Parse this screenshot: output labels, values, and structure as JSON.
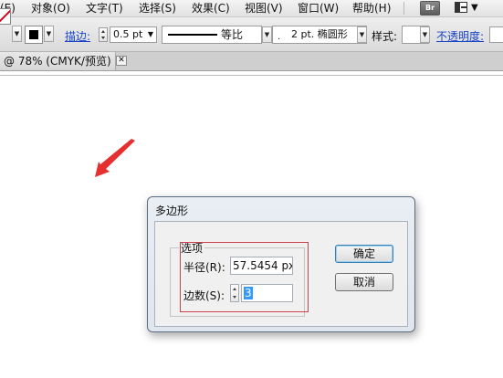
{
  "menubar": {
    "items": [
      {
        "label": "(E)"
      },
      {
        "label": "对象(O)"
      },
      {
        "label": "文字(T)"
      },
      {
        "label": "选择(S)"
      },
      {
        "label": "效果(C)"
      },
      {
        "label": "视图(V)"
      },
      {
        "label": "窗口(W)"
      },
      {
        "label": "帮助(H)"
      }
    ],
    "bridge_badge": "Br"
  },
  "controlbar": {
    "stroke_label": "描边:",
    "stroke_weight": "0.5 pt",
    "profile_label": "等比",
    "brush_label": "2 pt. 椭圆形",
    "style_label": "样式:",
    "opacity_label": "不透明度:",
    "stroke_color": "#d2001c",
    "fill_color": "#000000"
  },
  "document_tab": {
    "label": "@ 78% (CMYK/预览)",
    "close_glyph": "✕"
  },
  "dialog": {
    "title": "多边形",
    "group_label": "选项",
    "radius_label": "半径(R):",
    "radius_value": "57.5454 px",
    "sides_label": "边数(S):",
    "sides_value": "3",
    "ok_label": "确定",
    "cancel_label": "取消"
  },
  "annotations": {
    "arrow_color": "#e63030",
    "highlight_color": "#d2414b"
  }
}
